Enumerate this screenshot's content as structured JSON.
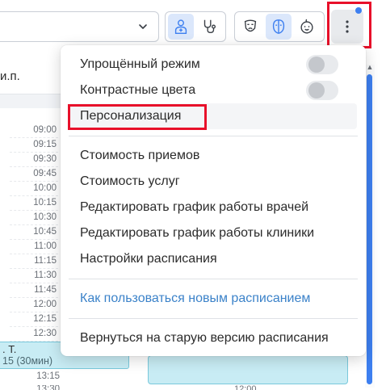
{
  "toolbar": {
    "doctor_view_icon": "doctor-icon",
    "stethoscope_icon": "stethoscope-icon",
    "face_icons": [
      "mask-icon",
      "face-profile-icon",
      "child-face-icon"
    ],
    "more_icon": "more-vertical-icon",
    "accent_color": "#3d7ff0",
    "highlight_color": "#e8102a"
  },
  "schedule": {
    "doctor_name": "и.п.",
    "times": [
      "09:00",
      "09:15",
      "09:30",
      "09:45",
      "10:00",
      "10:15",
      "10:30",
      "10:45",
      "11:00",
      "11:15",
      "11:30",
      "11:45",
      "12:00",
      "12:15",
      "12:30"
    ],
    "appointment": {
      "line1": ". Т.",
      "line2": "15 (30мин)"
    },
    "time_after": "13:15",
    "time_partial": "13:30",
    "bottom_time": "12:00"
  },
  "menu": {
    "simplified_mode": "Упрощённый режим",
    "contrast_colors": "Контрастные цвета",
    "personalization": "Персонализация",
    "appointment_cost": "Стоимость приемов",
    "services_cost": "Стоимость услуг",
    "edit_doctors_schedule": "Редактировать график работы врачей",
    "edit_clinic_schedule": "Редактировать график работы клиники",
    "schedule_settings": "Настройки расписания",
    "how_to_use": "Как пользоваться новым расписанием",
    "return_old": "Вернуться на старую версию расписания"
  }
}
